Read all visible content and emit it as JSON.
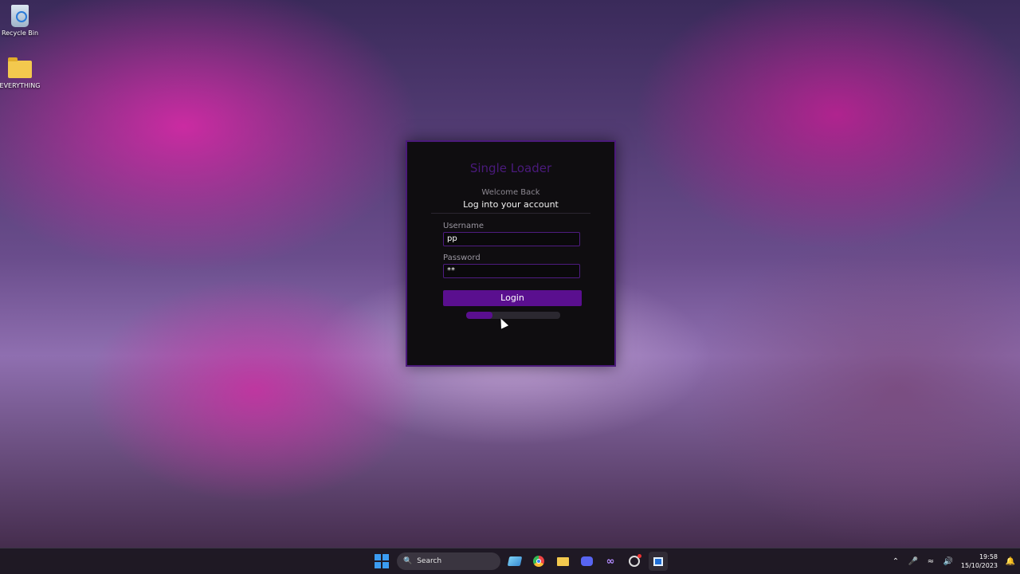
{
  "desktop": {
    "icons": [
      {
        "label": "Recycle Bin",
        "icon": "recycle-bin-icon"
      },
      {
        "label": "EVERYTHING",
        "icon": "folder-icon"
      }
    ]
  },
  "login": {
    "brand": "Single Loader",
    "welcome": "Welcome Back",
    "subtitle": "Log into your account",
    "username_label": "Username",
    "username_value": "pp",
    "password_label": "Password",
    "password_value": "**",
    "login_button": "Login",
    "progress": 0.28
  },
  "taskbar": {
    "search_label": "Search",
    "apps": [
      "snipping-tool-icon",
      "chrome-icon",
      "file-explorer-icon",
      "discord-icon",
      "visual-studio-icon",
      "steam-icon",
      "app-window-icon"
    ],
    "time": "19:58",
    "date": "15/10/2023"
  },
  "colors": {
    "accent": "#5a0f8f",
    "panel_bg": "#0f0d10",
    "brand_text": "#4a1a7c"
  }
}
